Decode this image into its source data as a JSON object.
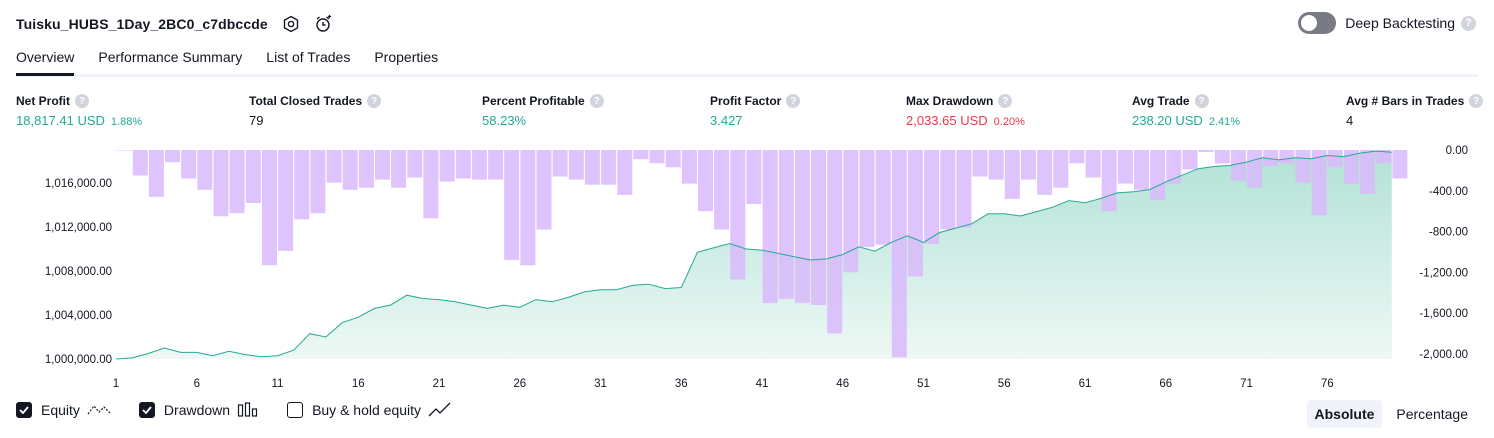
{
  "header": {
    "title": "Tuisku_HUBS_1Day_2BC0_c7dbccde",
    "deep_backtesting_label": "Deep Backtesting",
    "deep_backtesting_on": false,
    "help_glyph": "?"
  },
  "tabs": [
    {
      "label": "Overview",
      "active": true
    },
    {
      "label": "Performance Summary",
      "active": false
    },
    {
      "label": "List of Trades",
      "active": false
    },
    {
      "label": "Properties",
      "active": false
    }
  ],
  "metrics": [
    {
      "label": "Net Profit",
      "value": "18,817.41 USD",
      "pct": "1.88%",
      "color": "green"
    },
    {
      "label": "Total Closed Trades",
      "value": "79",
      "pct": "",
      "color": "dark"
    },
    {
      "label": "Percent Profitable",
      "value": "58.23%",
      "pct": "",
      "color": "green"
    },
    {
      "label": "Profit Factor",
      "value": "3.427",
      "pct": "",
      "color": "green"
    },
    {
      "label": "Max Drawdown",
      "value": "2,033.65 USD",
      "pct": "0.20%",
      "color": "red"
    },
    {
      "label": "Avg Trade",
      "value": "238.20 USD",
      "pct": "2.41%",
      "color": "green"
    },
    {
      "label": "Avg # Bars in Trades",
      "value": "4",
      "pct": "",
      "color": "dark"
    }
  ],
  "legend": {
    "equity_label": "Equity",
    "equity_checked": true,
    "drawdown_label": "Drawdown",
    "drawdown_checked": true,
    "buyhold_label": "Buy & hold equity",
    "buyhold_checked": false,
    "equity_icon": "equity-line-icon",
    "drawdown_icon": "drawdown-bars-icon",
    "buyhold_icon": "buyhold-line-icon"
  },
  "scale_toggle": {
    "absolute_label": "Absolute",
    "percentage_label": "Percentage",
    "selected": "Absolute"
  },
  "colors": {
    "equity_line": "#22ab94",
    "equity_fill_top": "#b2e2d6",
    "equity_fill_bottom": "#eef8f5",
    "drawdown_bar": "#d9b8fb",
    "drawdown_bar_over": "#b5b0e8",
    "text": "#131722",
    "profit": "#22ab94",
    "loss": "#f23645"
  },
  "chart_data": {
    "type": "line+bar",
    "x": [
      1,
      2,
      3,
      4,
      5,
      6,
      7,
      8,
      9,
      10,
      11,
      12,
      13,
      14,
      15,
      16,
      17,
      18,
      19,
      20,
      21,
      22,
      23,
      24,
      25,
      26,
      27,
      28,
      29,
      30,
      31,
      32,
      33,
      34,
      35,
      36,
      37,
      38,
      39,
      40,
      41,
      42,
      43,
      44,
      45,
      46,
      47,
      48,
      49,
      50,
      51,
      52,
      53,
      54,
      55,
      56,
      57,
      58,
      59,
      60,
      61,
      62,
      63,
      64,
      65,
      66,
      67,
      68,
      69,
      70,
      71,
      72,
      73,
      74,
      75,
      76,
      77,
      78,
      79,
      80
    ],
    "xticks": [
      1,
      6,
      11,
      16,
      21,
      26,
      31,
      36,
      41,
      46,
      51,
      56,
      61,
      66,
      71,
      76
    ],
    "series": [
      {
        "name": "Equity",
        "axis": "left",
        "values": [
          1000000,
          1000100,
          1000500,
          1001000,
          1000600,
          1000600,
          1000300,
          1000700,
          1000400,
          1000200,
          1000300,
          1000800,
          1002300,
          1002000,
          1003300,
          1003800,
          1004600,
          1004900,
          1005800,
          1005500,
          1005400,
          1005200,
          1004900,
          1004600,
          1004900,
          1004700,
          1005400,
          1005200,
          1005600,
          1006100,
          1006300,
          1006300,
          1006700,
          1006800,
          1006400,
          1006500,
          1009700,
          1010100,
          1010500,
          1010000,
          1009900,
          1009600,
          1009300,
          1009000,
          1009100,
          1009500,
          1010200,
          1009800,
          1010600,
          1011200,
          1010600,
          1011500,
          1011900,
          1012300,
          1013200,
          1013200,
          1013000,
          1013400,
          1013800,
          1014400,
          1014200,
          1014600,
          1015100,
          1015200,
          1015400,
          1016100,
          1016700,
          1017300,
          1017500,
          1017600,
          1017900,
          1018300,
          1018100,
          1018300,
          1018200,
          1018500,
          1018400,
          1018700,
          1018900,
          1018800
        ]
      },
      {
        "name": "Drawdown",
        "axis": "right",
        "values": [
          0,
          -250,
          -460,
          -120,
          -280,
          -390,
          -650,
          -620,
          -520,
          -1130,
          -990,
          -680,
          -620,
          -320,
          -390,
          -370,
          -290,
          -370,
          -270,
          -670,
          -310,
          -280,
          -290,
          -290,
          -1080,
          -1130,
          -780,
          -260,
          -290,
          -340,
          -340,
          -440,
          -90,
          -130,
          -170,
          -330,
          -600,
          -780,
          -1270,
          -530,
          -1500,
          -1460,
          -1500,
          -1520,
          -1800,
          -1200,
          -950,
          -930,
          -2033,
          -1240,
          -920,
          -780,
          -760,
          -260,
          -290,
          -480,
          -290,
          -440,
          -370,
          -130,
          -270,
          -600,
          -330,
          -390,
          -490,
          -330,
          -190,
          -20,
          -130,
          -300,
          -370,
          -160,
          -130,
          -320,
          -640,
          -170,
          -330,
          -430,
          -130,
          -280
        ]
      }
    ],
    "ylim_left": [
      1000000,
      1019000
    ],
    "yticks_left": [
      "1,000,000.00",
      "1,004,000.00",
      "1,008,000.00",
      "1,012,000.00",
      "1,016,000.00"
    ],
    "ylim_right": [
      -2050,
      0
    ],
    "yticks_right": [
      "0.00",
      "-400.00",
      "-800.00",
      "-1,200.00",
      "-1,600.00",
      "-2,000.00"
    ],
    "legend": [
      "Equity",
      "Drawdown",
      "Buy & hold equity"
    ]
  }
}
